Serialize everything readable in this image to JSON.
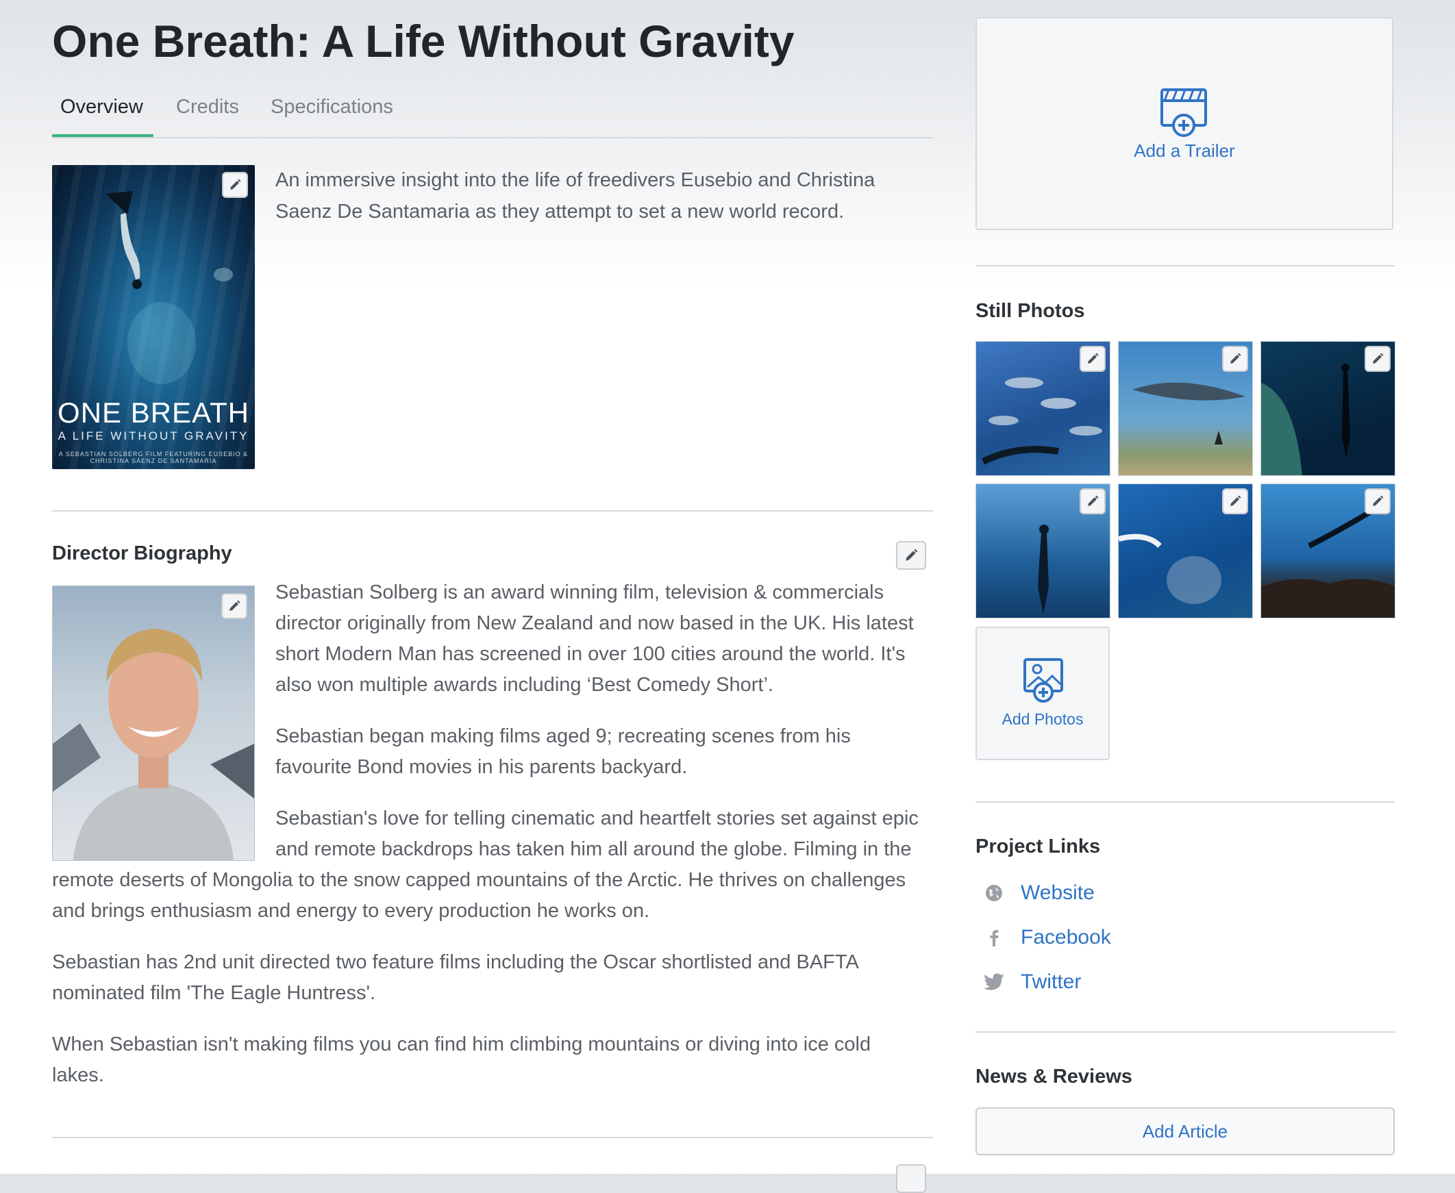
{
  "project": {
    "title": "One Breath: A Life Without Gravity",
    "synopsis": "An immersive insight into the life of freedivers Eusebio and Christina Saenz De Santamaria as they attempt to set a new world record."
  },
  "tabs": [
    {
      "label": "Overview",
      "active": true
    },
    {
      "label": "Credits",
      "active": false
    },
    {
      "label": "Specifications",
      "active": false
    }
  ],
  "poster": {
    "title": "ONE BREATH",
    "subtitle": "A LIFE WITHOUT GRAVITY",
    "credits": "A SEBASTIAN SOLBERG FILM   FEATURING EUSEBIO & CHRISTINA SÁENZ DE SANTAMARÍA"
  },
  "director": {
    "heading": "Director Biography",
    "paragraphs": [
      "Sebastian Solberg is an award winning film, television & commercials director originally from New Zealand and now based in the UK. His latest short Modern Man has screened in over 100 cities around the world. It's also won multiple awards including ‘Best Comedy Short’.",
      "Sebastian began making films aged 9; recreating scenes from his favourite Bond movies in his parents backyard.",
      "Sebastian's love for telling cinematic and heartfelt stories set against epic and remote backdrops has taken him all around the globe. Filming in the remote deserts of Mongolia to the snow capped mountains of the Arctic. He thrives on challenges and brings enthusiasm and energy to every production he works on.",
      "Sebastian has 2nd unit directed two feature films including the Oscar shortlisted and BAFTA nominated film 'The Eagle Huntress'.",
      "When Sebastian isn't making films you can find him climbing mountains or diving into ice cold lakes."
    ]
  },
  "sidebar": {
    "trailer_label": "Add a Trailer",
    "still_photos_heading": "Still Photos",
    "add_photos_label": "Add Photos",
    "project_links_heading": "Project Links",
    "links": [
      {
        "label": "Website",
        "icon": "globe-icon"
      },
      {
        "label": "Facebook",
        "icon": "facebook-icon"
      },
      {
        "label": "Twitter",
        "icon": "twitter-icon"
      }
    ],
    "news_heading": "News & Reviews",
    "add_article_label": "Add Article"
  },
  "colors": {
    "accent_tab": "#37b37e",
    "link_blue": "#2f73c5",
    "title_text": "#22262b"
  }
}
